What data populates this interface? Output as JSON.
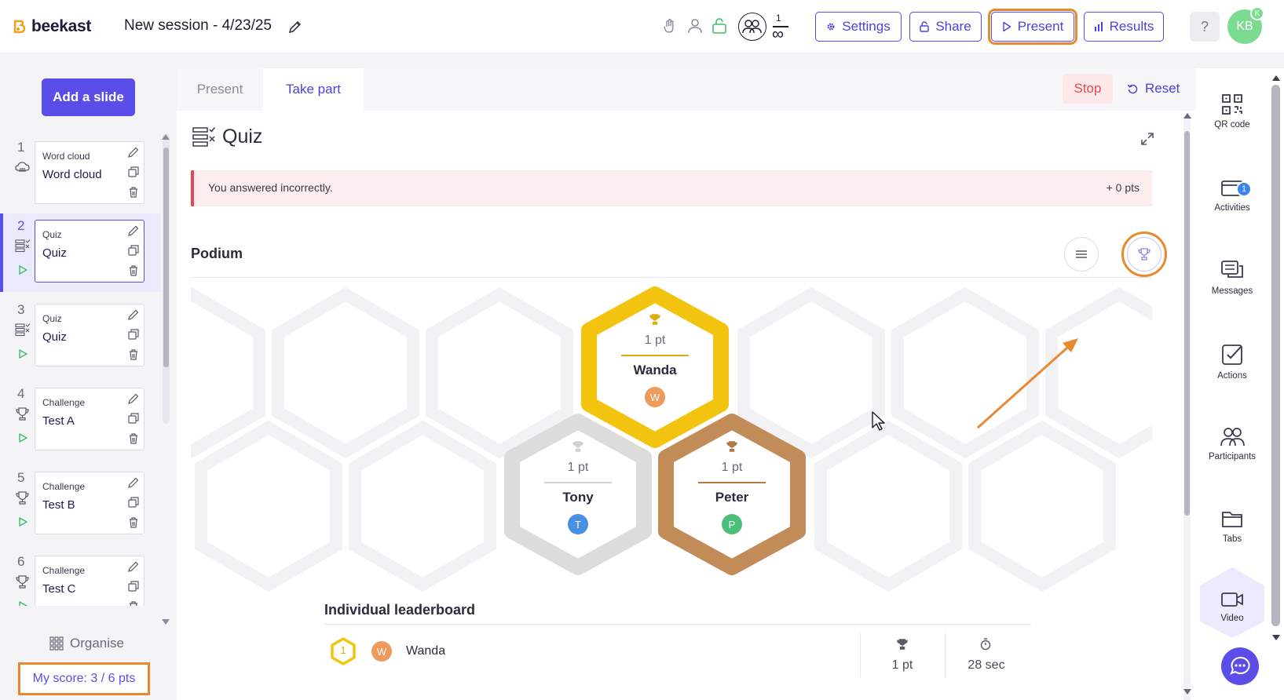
{
  "header": {
    "logo": "beekast",
    "session_title": "New session - 4/23/25",
    "participants_count": "1",
    "participants_limit": "∞",
    "buttons": {
      "settings": "Settings",
      "share": "Share",
      "present": "Present",
      "results": "Results"
    },
    "help": "?",
    "user_initials": "KB",
    "user_badge": "K"
  },
  "sidebar": {
    "add_slide": "Add a slide",
    "slides": [
      {
        "num": "1",
        "type": "Word cloud",
        "title": "Word cloud"
      },
      {
        "num": "2",
        "type": "Quiz",
        "title": "Quiz"
      },
      {
        "num": "3",
        "type": "Quiz",
        "title": "Quiz"
      },
      {
        "num": "4",
        "type": "Challenge",
        "title": "Test A"
      },
      {
        "num": "5",
        "type": "Challenge",
        "title": "Test B"
      },
      {
        "num": "6",
        "type": "Challenge",
        "title": "Test C"
      }
    ],
    "organise": "Organise",
    "score": "My score: 3 / 6 pts"
  },
  "main": {
    "tabs": [
      "Present",
      "Take part"
    ],
    "stop": "Stop",
    "reset": "Reset",
    "activity_title": "Quiz",
    "alert": {
      "text": "You answered incorrectly.",
      "points": "+ 0 pts"
    },
    "podium_title": "Podium",
    "podium": [
      {
        "rank": 1,
        "points": "1 pt",
        "name": "Wanda",
        "initial": "W",
        "avatar_color": "#ee9a5a",
        "frame_color": "#f2c40f"
      },
      {
        "rank": 2,
        "points": "1 pt",
        "name": "Tony",
        "initial": "T",
        "avatar_color": "#4a90e2",
        "frame_color": "#dcdcdc"
      },
      {
        "rank": 3,
        "points": "1 pt",
        "name": "Peter",
        "initial": "P",
        "avatar_color": "#4cc079",
        "frame_color": "#c28c58"
      }
    ],
    "leaderboard_title": "Individual leaderboard",
    "leaderboard": [
      {
        "rank": "1",
        "initial": "W",
        "name": "Wanda",
        "points": "1 pt",
        "time": "28 sec"
      }
    ]
  },
  "rail": {
    "items": [
      "QR code",
      "Activities",
      "Messages",
      "Actions",
      "Participants",
      "Tabs",
      "Video"
    ],
    "activities_badge": "1"
  },
  "colors": {
    "accent": "#5b4ee8",
    "highlight": "#e8892f",
    "danger": "#e34856"
  }
}
